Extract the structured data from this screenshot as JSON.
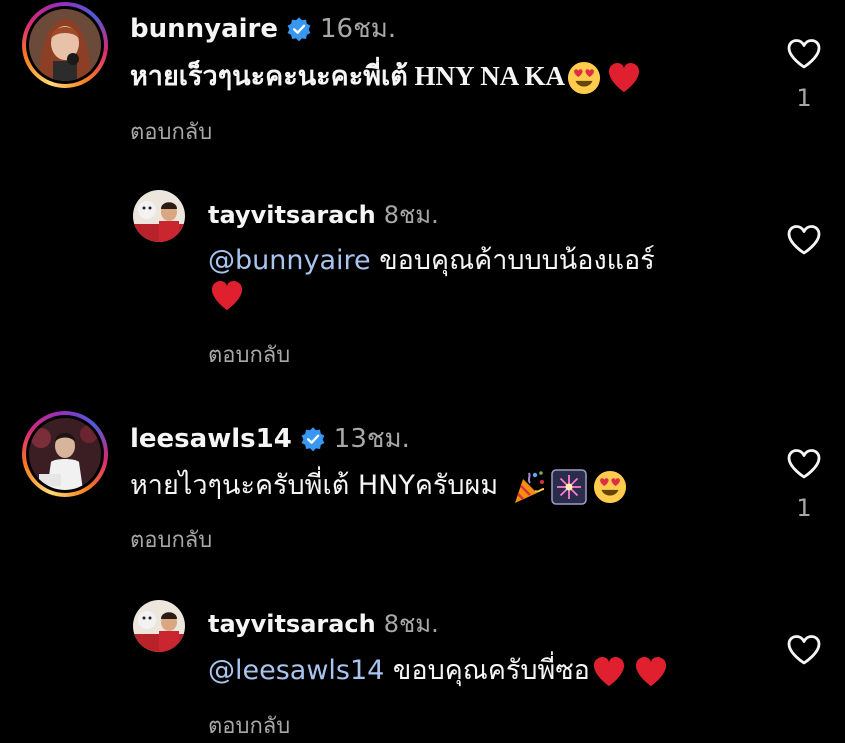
{
  "comments": [
    {
      "username": "bunnyaire",
      "verified": true,
      "time": "16ชม.",
      "text": "หายเร็วๆนะคะนะคะพี่เต้ HNY NA KA",
      "emojis": [
        "heart-eyes",
        "red-heart"
      ],
      "reply_label": "ตอบกลับ",
      "like_count": "1",
      "avatar": "ring"
    },
    {
      "username": "tayvitsarach",
      "verified": false,
      "time": "8ชม.",
      "mention": "@bunnyaire",
      "text": " ขอบคุณค้าบบบน้องแอร์",
      "emojis": [
        "red-heart"
      ],
      "reply_label": "ตอบกลับ",
      "avatar": "plain"
    },
    {
      "username": "leesawls14",
      "verified": true,
      "time": "13ชม.",
      "text": "หายไวๆนะครับพี่เต้ HNYครับผม",
      "emojis": [
        "party-popper",
        "sparkler",
        "heart-eyes"
      ],
      "reply_label": "ตอบกลับ",
      "like_count": "1",
      "avatar": "ring"
    },
    {
      "username": "tayvitsarach",
      "verified": false,
      "time": "8ชม.",
      "mention": "@leesawls14",
      "text": " ขอบคุณครับพี่ซอ",
      "emojis": [
        "red-heart",
        "red-heart"
      ],
      "reply_label": "ตอบกลับ",
      "avatar": "plain"
    }
  ],
  "colors": {
    "background": "#000000",
    "text": "#f5f5f5",
    "secondary": "#a8a8a8",
    "mention": "#a9c4ee",
    "verified": "#3897f0",
    "heart": "#e0202f"
  }
}
